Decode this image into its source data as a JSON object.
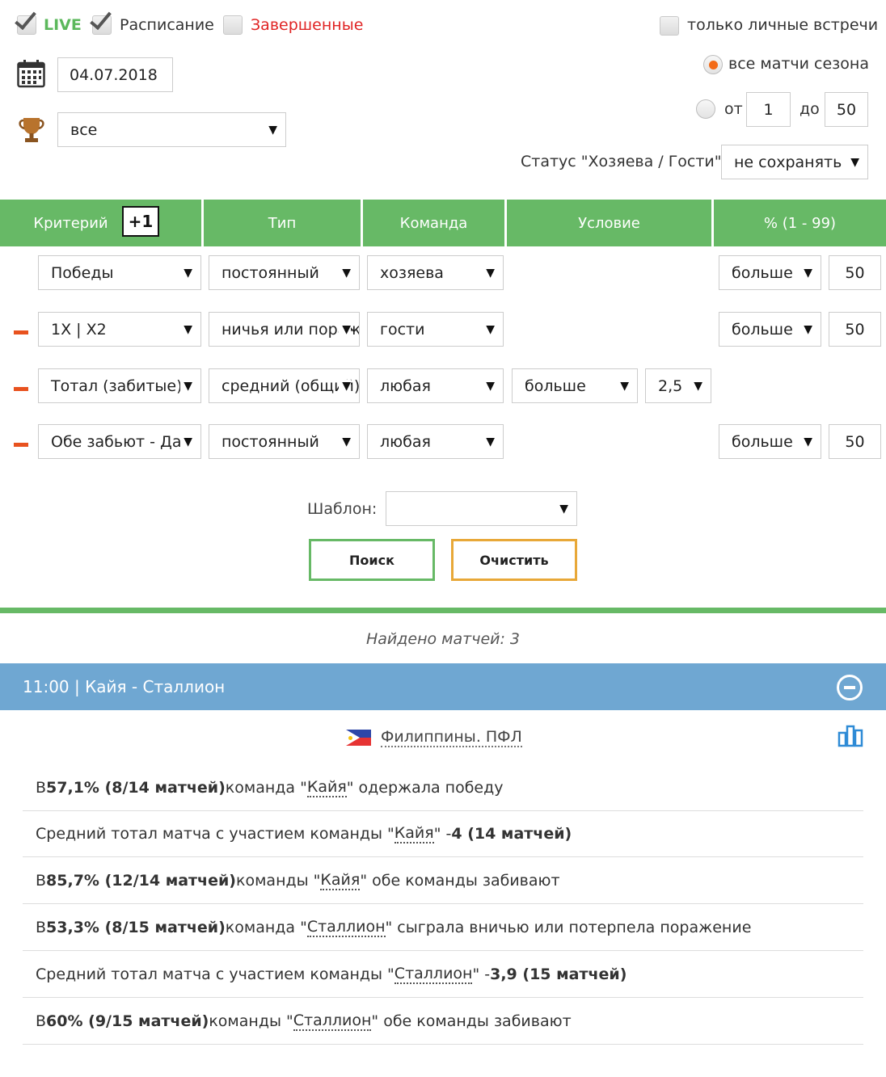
{
  "filters": {
    "live_label": "LIVE",
    "schedule_label": "Расписание",
    "finished_label": "Завершенные",
    "h2h_label": "только личные встречи",
    "date": "04.07.2018",
    "league_value": "все",
    "all_season_label": "все матчи сезона",
    "from_label": "от",
    "from_value": "1",
    "to_label": "до",
    "to_value": "50",
    "status_label": "Статус \"Хозяева / Гости\"",
    "status_value": "не сохранять"
  },
  "table_header": {
    "criterion": "Критерий",
    "plus": "+1",
    "type": "Тип",
    "team": "Команда",
    "condition": "Условие",
    "percent": "% (1 - 99)"
  },
  "rows": [
    {
      "criterion": "Победы",
      "type": "постоянный",
      "team": "хозяева",
      "compare": "больше",
      "percent": "50"
    },
    {
      "criterion": "1X | X2",
      "type": "ничья или поражение",
      "team": "гости",
      "compare": "больше",
      "percent": "50"
    },
    {
      "criterion": "Тотал (забитые)",
      "type": "средний (общий)",
      "team": "любая",
      "cond": "больше",
      "cond_value": "2,5"
    },
    {
      "criterion": "Обе забьют - Да",
      "type": "постоянный",
      "team": "любая",
      "compare": "больше",
      "percent": "50"
    }
  ],
  "template": {
    "label": "Шаблон:",
    "value": ""
  },
  "buttons": {
    "search": "Поиск",
    "clear": "Очистить"
  },
  "found_text": "Найдено матчей: 3",
  "match": {
    "title": "11:00 | Кайя - Сталлион",
    "league": "Филиппины. ПФЛ"
  },
  "stats": [
    {
      "pre": "В ",
      "bold": "57,1% (8/14 матчей)",
      "mid": " команда \"",
      "team": "Кайя",
      "post": "\" одержала победу",
      "bold2": ""
    },
    {
      "pre": "Средний тотал матча с участием команды \"",
      "bold": "",
      "mid": "",
      "team": "Кайя",
      "post": "\" - ",
      "bold2": "4 (14 матчей)"
    },
    {
      "pre": "В ",
      "bold": "85,7% (12/14 матчей)",
      "mid": " команды \"",
      "team": "Кайя",
      "post": "\" обе команды забивают",
      "bold2": ""
    },
    {
      "pre": "В ",
      "bold": "53,3% (8/15 матчей)",
      "mid": " команда \"",
      "team": "Сталлион",
      "post": "\" сыграла вничью или потерпела поражение",
      "bold2": ""
    },
    {
      "pre": "Средний тотал матча с участием команды \"",
      "bold": "",
      "mid": "",
      "team": "Сталлион",
      "post": "\" - ",
      "bold2": "3,9 (15 матчей)"
    },
    {
      "pre": "В ",
      "bold": "60% (9/15 матчей)",
      "mid": " команды \"",
      "team": "Сталлион",
      "post": "\" обе команды забивают",
      "bold2": ""
    }
  ],
  "colors": {
    "green": "#67b966",
    "blue": "#6fa7d2",
    "orange": "#e8a838",
    "red": "#e02424"
  }
}
